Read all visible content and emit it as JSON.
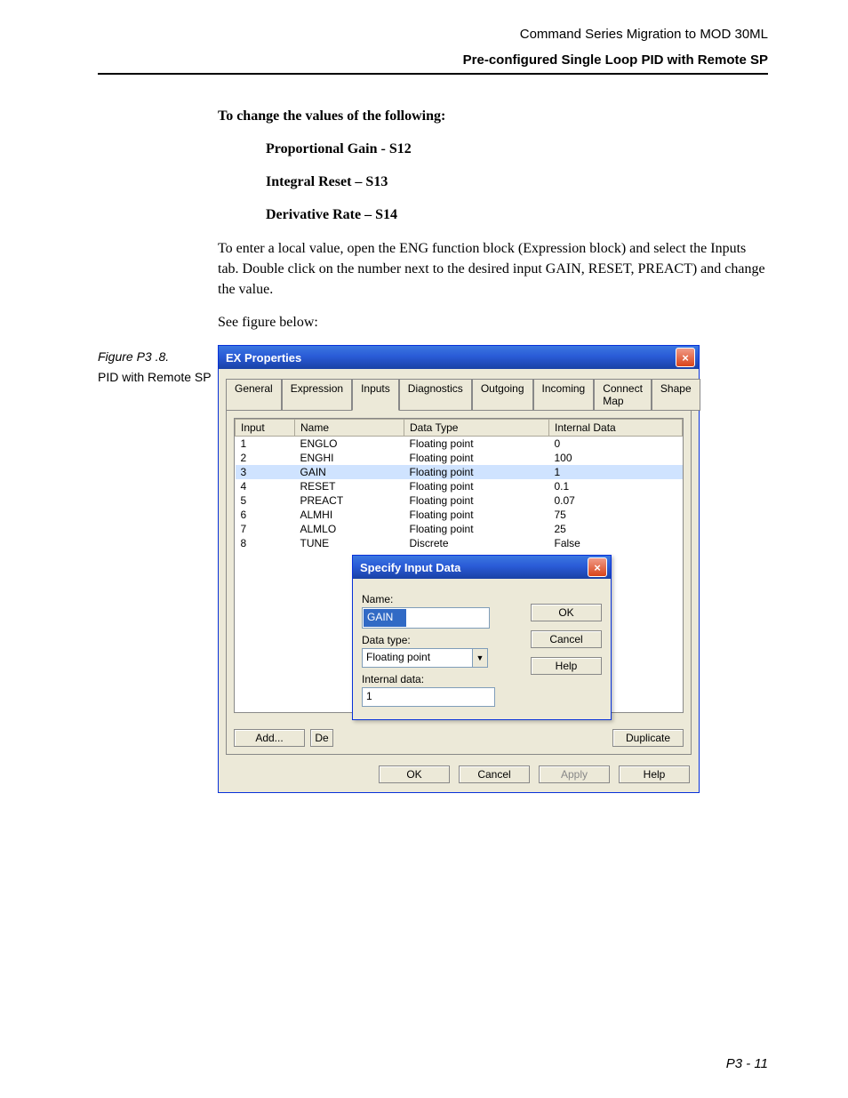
{
  "header": {
    "top": "Command Series Migration to MOD 30ML",
    "sub": "Pre-configured Single Loop PID with Remote SP"
  },
  "text": {
    "heading": "To change the values of the following:",
    "l1": "Proportional Gain - S12",
    "l2": "Integral Reset – S13",
    "l3": "Derivative Rate – S14",
    "para1": "To enter a local value, open the ENG function block (Expression block) and select the Inputs tab. Double click on the number next to the desired input GAIN, RESET, PREACT) and change the value.",
    "para2": "See figure below:"
  },
  "figure": {
    "number": "Figure P3 .8.",
    "caption": "PID with Remote SP"
  },
  "dialog1": {
    "title": "EX Properties",
    "tabs": [
      "General",
      "Expression",
      "Inputs",
      "Diagnostics",
      "Outgoing",
      "Incoming",
      "Connect Map",
      "Shape"
    ],
    "activeTab": 2,
    "columns": [
      "Input",
      "Name",
      "Data Type",
      "Internal Data"
    ],
    "rows": [
      {
        "input": "1",
        "name": "ENGLO",
        "dtype": "Floating point",
        "data": "0"
      },
      {
        "input": "2",
        "name": "ENGHI",
        "dtype": "Floating point",
        "data": "100"
      },
      {
        "input": "3",
        "name": "GAIN",
        "dtype": "Floating point",
        "data": "1",
        "selected": true
      },
      {
        "input": "4",
        "name": "RESET",
        "dtype": "Floating point",
        "data": "0.1"
      },
      {
        "input": "5",
        "name": "PREACT",
        "dtype": "Floating point",
        "data": "0.07"
      },
      {
        "input": "6",
        "name": "ALMHI",
        "dtype": "Floating point",
        "data": "75"
      },
      {
        "input": "7",
        "name": "ALMLO",
        "dtype": "Floating point",
        "data": "25"
      },
      {
        "input": "8",
        "name": "TUNE",
        "dtype": "Discrete",
        "data": "False"
      }
    ],
    "buttons": {
      "add": "Add...",
      "del": "De",
      "dup": "Duplicate",
      "ok": "OK",
      "cancel": "Cancel",
      "apply": "Apply",
      "help": "Help"
    }
  },
  "dialog2": {
    "title": "Specify Input Data",
    "labels": {
      "name": "Name:",
      "dtype": "Data type:",
      "idata": "Internal data:"
    },
    "values": {
      "name": "GAIN",
      "dtype": "Floating point",
      "idata": "1"
    },
    "buttons": {
      "ok": "OK",
      "cancel": "Cancel",
      "help": "Help"
    }
  },
  "pageNumber": "P3 - 11"
}
